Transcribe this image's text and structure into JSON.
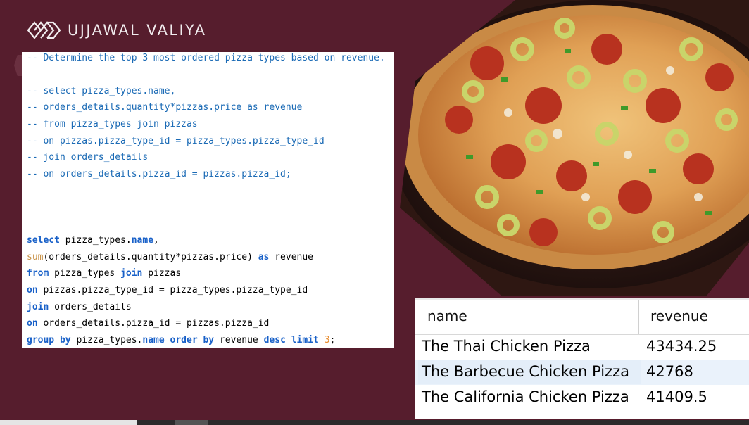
{
  "brand": {
    "name": "UJJAWAL VALIYA"
  },
  "sql": {
    "comment_lines": [
      "-- Determine the top 3 most ordered pizza types based on revenue.",
      "-- select pizza_types.name,",
      "-- orders_details.quantity*pizzas.price as revenue",
      "-- from pizza_types join pizzas",
      "-- on pizzas.pizza_type_id = pizza_types.pizza_type_id",
      "-- join orders_details",
      "-- on orders_details.pizza_id = pizzas.pizza_id;"
    ],
    "query": {
      "select_kw": "select",
      "select_rest": " pizza_types.",
      "name_kw": "name",
      "select_end": ",",
      "sum_fn": "sum",
      "sum_rest": "(orders_details.quantity*pizzas.price) ",
      "as_kw": "as",
      "as_rest": " revenue",
      "from_kw": "from",
      "from_rest": " pizza_types ",
      "join_kw": "join",
      "join_rest": " pizzas",
      "on_kw": "on",
      "on_rest": " pizzas.pizza_type_id = pizza_types.pizza_type_id",
      "join2_kw": "join",
      "join2_rest": " orders_details",
      "on2_kw": "on",
      "on2_rest": " orders_details.pizza_id = pizzas.pizza_id",
      "group_kw": "group by",
      "group_rest": " pizza_types.",
      "group_name_kw": "name",
      "order_kw": "order by",
      "order_rest": " revenue ",
      "desc_kw": "desc",
      "limit_kw": "limit",
      "limit_num": "3",
      "end": ";"
    }
  },
  "result": {
    "columns": [
      "name",
      "revenue"
    ],
    "rows": [
      {
        "name": "The Thai Chicken Pizza",
        "revenue": "43434.25"
      },
      {
        "name": "The Barbecue Chicken Pizza",
        "revenue": "42768"
      },
      {
        "name": "The California Chicken Pizza",
        "revenue": "41409.5"
      }
    ]
  },
  "colors": {
    "background": "#561d2d",
    "comment": "#1a6ab5",
    "keyword": "#1860c8",
    "function": "#c89146",
    "number": "#e88a2a"
  }
}
